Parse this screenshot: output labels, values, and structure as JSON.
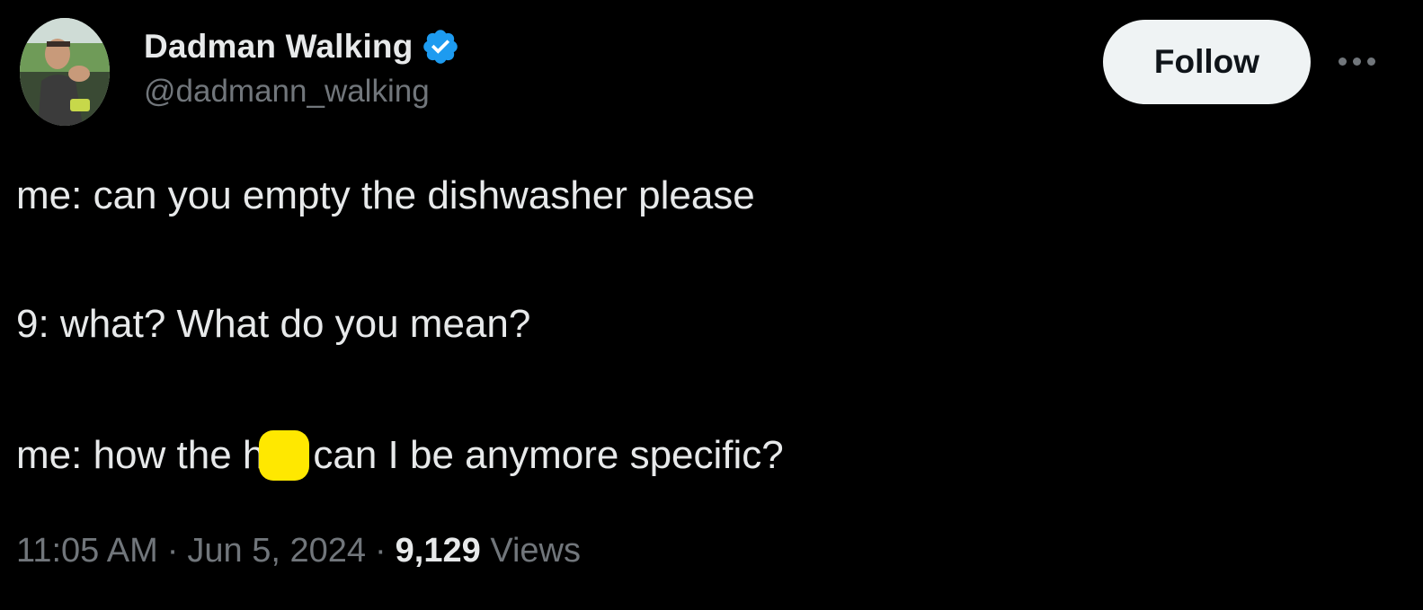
{
  "author": {
    "display_name": "Dadman Walking",
    "handle": "@dadmann_walking",
    "verified": true
  },
  "actions": {
    "follow_label": "Follow"
  },
  "tweet": {
    "line1": "me: can you empty the dishwasher please",
    "line2": "9: what? What do you mean?",
    "line3_before": "me: how the h",
    "line3_after": "can I be anymore specific?"
  },
  "meta": {
    "time": "11:05 AM",
    "date": "Jun 5, 2024",
    "separator": "·",
    "views_count": "9,129",
    "views_label": "Views"
  },
  "colors": {
    "background": "#000000",
    "text_primary": "#e7e9ea",
    "text_secondary": "#71767b",
    "verified_badge": "#1d9bf0",
    "follow_button_bg": "#eff3f4",
    "redaction": "#ffe800"
  },
  "icons": {
    "verified": "verified-badge-icon",
    "more": "more-options-icon"
  }
}
